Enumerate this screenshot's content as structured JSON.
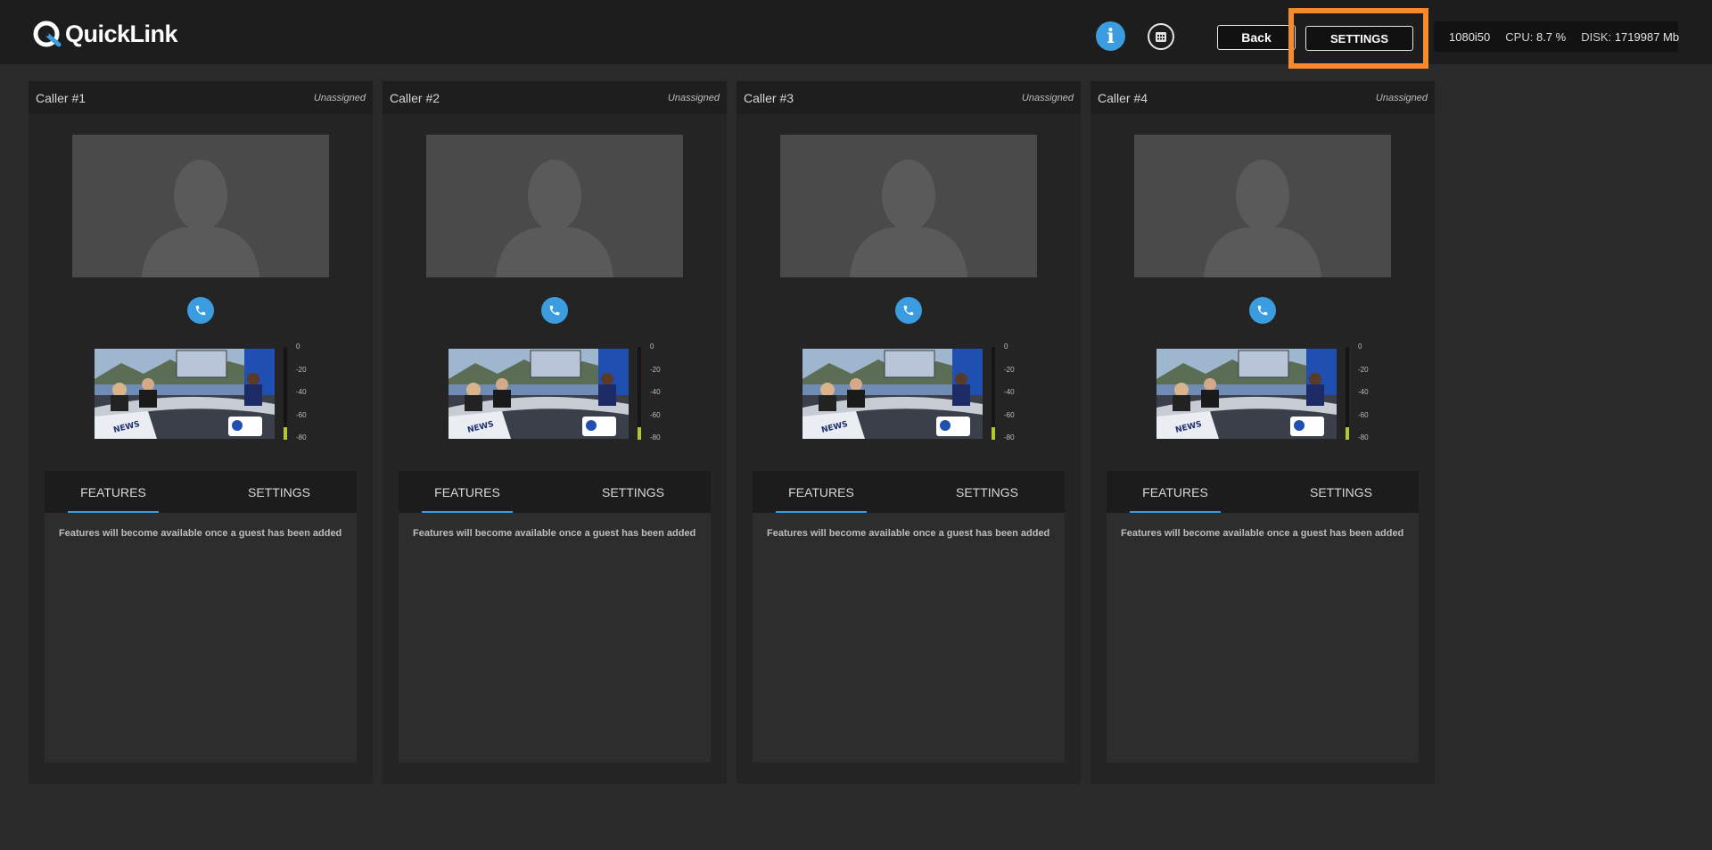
{
  "app": {
    "brand": "QuickLink",
    "accent_color": "#3b9de0",
    "highlight_color": "#f68a2c"
  },
  "header": {
    "info_icon": "info-icon",
    "calendar_icon": "calendar-icon",
    "back_label": "Back",
    "settings_label": "SETTINGS",
    "status": {
      "format": "1080i50",
      "cpu_label": "CPU:",
      "cpu_value": "8.7 %",
      "disk_label": "DISK:",
      "disk_value": "1719987 Mb"
    }
  },
  "callers": [
    {
      "name": "Caller #1",
      "status": "Unassigned",
      "call_icon": "phone-icon",
      "audio_meter": {
        "scale": [
          "0",
          "-20",
          "-40",
          "-60",
          "-80"
        ],
        "level_db": -65
      },
      "tabs": [
        "FEATURES",
        "SETTINGS"
      ],
      "active_tab": "FEATURES",
      "features_message": "Features will become available once a guest has been added"
    },
    {
      "name": "Caller #2",
      "status": "Unassigned",
      "call_icon": "phone-icon",
      "audio_meter": {
        "scale": [
          "0",
          "-20",
          "-40",
          "-60",
          "-80"
        ],
        "level_db": -65
      },
      "tabs": [
        "FEATURES",
        "SETTINGS"
      ],
      "active_tab": "FEATURES",
      "features_message": "Features will become available once a guest has been added"
    },
    {
      "name": "Caller #3",
      "status": "Unassigned",
      "call_icon": "phone-icon",
      "audio_meter": {
        "scale": [
          "0",
          "-20",
          "-40",
          "-60",
          "-80"
        ],
        "level_db": -65
      },
      "tabs": [
        "FEATURES",
        "SETTINGS"
      ],
      "active_tab": "FEATURES",
      "features_message": "Features will become available once a guest has been added"
    },
    {
      "name": "Caller #4",
      "status": "Unassigned",
      "call_icon": "phone-icon",
      "audio_meter": {
        "scale": [
          "0",
          "-20",
          "-40",
          "-60",
          "-80"
        ],
        "level_db": -65
      },
      "tabs": [
        "FEATURES",
        "SETTINGS"
      ],
      "active_tab": "FEATURES",
      "features_message": "Features will become available once a guest has been added"
    }
  ]
}
